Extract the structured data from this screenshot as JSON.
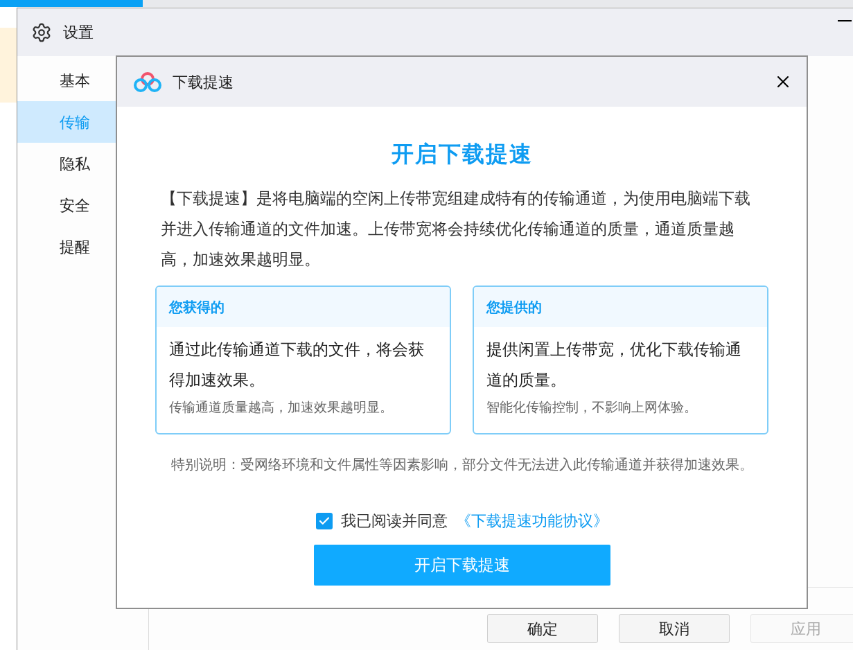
{
  "settings_window": {
    "title": "设置",
    "sidebar": {
      "items": [
        {
          "label": "基本",
          "selected": false
        },
        {
          "label": "传输",
          "selected": true
        },
        {
          "label": "隐私",
          "selected": false
        },
        {
          "label": "安全",
          "selected": false
        },
        {
          "label": "提醒",
          "selected": false
        }
      ]
    },
    "buttons": [
      {
        "label": "确定",
        "disabled": false
      },
      {
        "label": "取消",
        "disabled": false
      },
      {
        "label": "应用",
        "disabled": true
      }
    ]
  },
  "dialog": {
    "title": "下载提速",
    "heading": "开启下载提速",
    "description": "【下载提速】是将电脑端的空闲上传带宽组建成特有的传输通道，为使用电脑端下载并进入传输通道的文件加速。上传带宽将会持续优化传输通道的质量，通道质量越高，加速效果越明显。",
    "cards": [
      {
        "title": "您获得的",
        "body": "通过此传输通道下载的文件，将会获得加速效果。",
        "note": "传输通道质量越高，加速效果越明显。"
      },
      {
        "title": "您提供的",
        "body": "提供闲置上传带宽，优化下载传输通道的质量。",
        "note": "智能化传输控制，不影响上网体验。"
      }
    ],
    "notice": "特别说明：受网络环境和文件属性等因素影响，部分文件无法进入此传输通道并获得加速效果。",
    "agreement": {
      "checked": true,
      "label": "我已阅读并同意",
      "link": "《下载提速功能协议》"
    },
    "primary_button": "开启下载提速"
  }
}
